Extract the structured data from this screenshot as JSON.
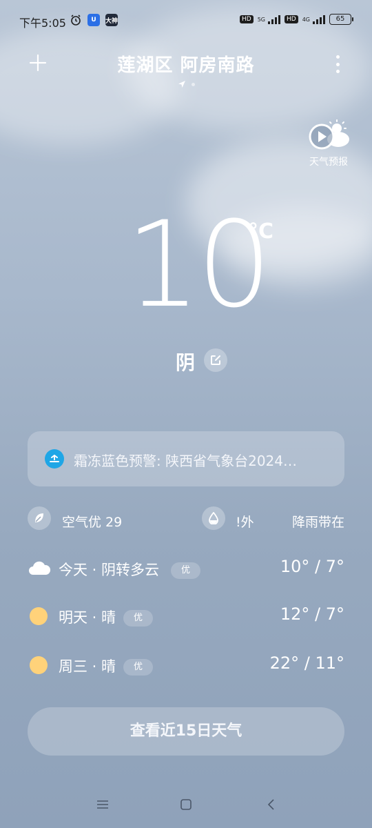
{
  "status_bar": {
    "time": "下午5:05",
    "app_badge_1": "U",
    "app_badge_2": "大神",
    "hd1": "HD",
    "net1": "5G",
    "hd2": "HD",
    "net2": "4G",
    "battery": "65"
  },
  "header": {
    "location": "莲湖区 阿房南路"
  },
  "forecast_video": {
    "label": "天气预报"
  },
  "current": {
    "temperature": "10",
    "unit": "°C",
    "condition": "阴"
  },
  "alert": {
    "text": "霜冻蓝色预警: 陕西省气象台2024…"
  },
  "metrics": {
    "air_quality": "空气优 29",
    "uv_text": "!外",
    "rain_text": "降雨带在"
  },
  "daily": [
    {
      "label": "今天 · 阴转多云",
      "aqi": "优",
      "temp": "10° / 7°",
      "icon": "cloud-icon"
    },
    {
      "label": "明天 · 晴",
      "aqi": "优",
      "temp": "12° / 7°",
      "icon": "sun-icon"
    },
    {
      "label": "周三 · 晴",
      "aqi": "优",
      "temp": "22° / 11°",
      "icon": "sun-icon"
    }
  ],
  "fifteen_day_button": "查看近15日天气",
  "colors": {
    "sun": "#ffd27a",
    "alert_icon": "#1fa6e6"
  }
}
